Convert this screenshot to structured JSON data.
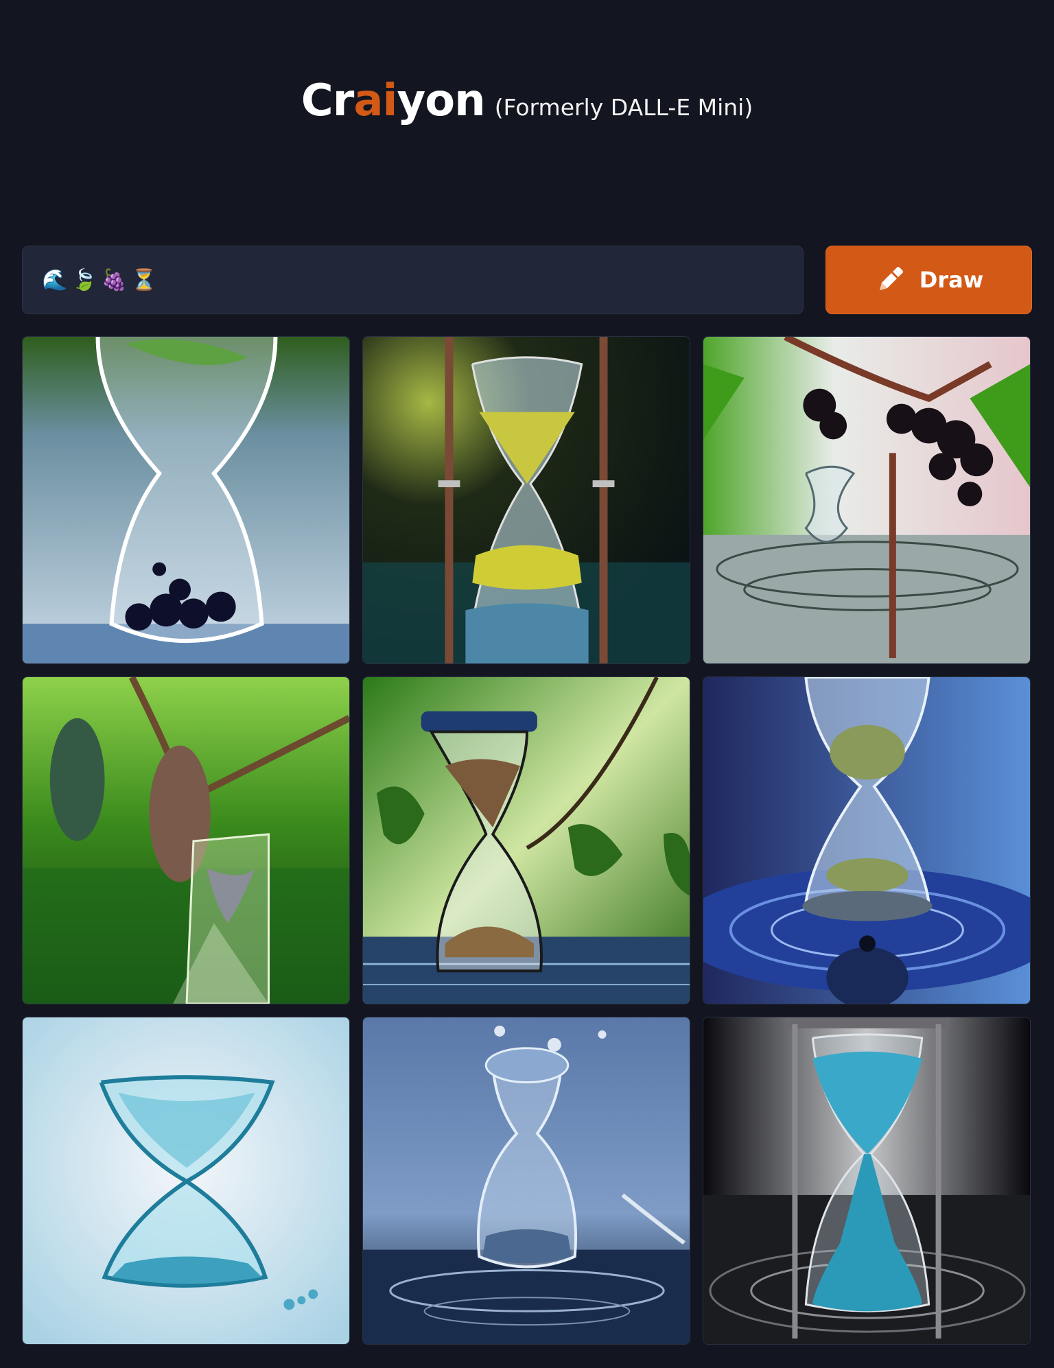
{
  "header": {
    "brand_part1": "Cr",
    "brand_accent": "ai",
    "brand_part2": "yon",
    "subtitle": "(Formerly DALL-E Mini)"
  },
  "colors": {
    "background": "#131620",
    "input_background": "#212638",
    "accent": "#d35917"
  },
  "prompt": {
    "value": "🌊🍃🍇⏳"
  },
  "draw_button": {
    "label": "Draw",
    "icon": "pencil-icon"
  },
  "results": [
    {
      "subject": "hourglass-with-grapes"
    },
    {
      "subject": "hourglass-yellow-sand"
    },
    {
      "subject": "grapes-over-water"
    },
    {
      "subject": "vine-hourglass-green"
    },
    {
      "subject": "hourglass-brown-sand-leaves"
    },
    {
      "subject": "hourglass-water-drop-blue"
    },
    {
      "subject": "hourglass-teal-light"
    },
    {
      "subject": "hourglass-water-splash"
    },
    {
      "subject": "hourglass-blue-sand-dark"
    }
  ]
}
